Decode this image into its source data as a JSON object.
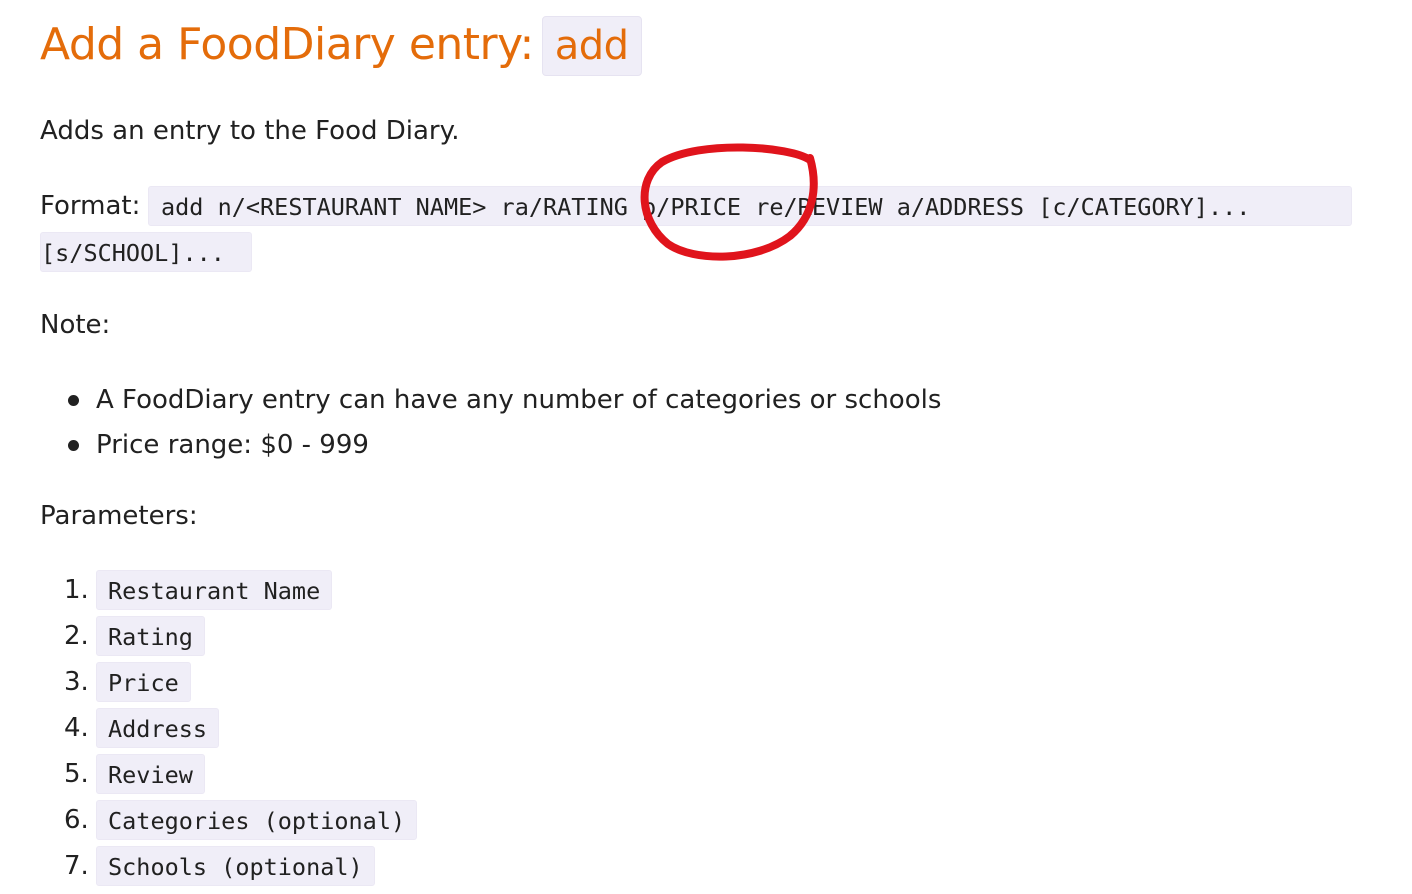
{
  "heading": {
    "text": "Add a FoodDiary entry:",
    "code": "add"
  },
  "intro": "Adds an entry to the Food Diary.",
  "format": {
    "label": "Format:",
    "line1": "add n/<RESTAURANT NAME> ra/RATING p/PRICE re/REVIEW a/ADDRESS [c/CATEGORY]...",
    "line2": "[s/SCHOOL]..."
  },
  "note_label": "Note:",
  "notes": [
    "A FoodDiary entry can have any number of categories or schools",
    "Price range: $0 - 999"
  ],
  "parameters_label": "Parameters:",
  "parameters": [
    {
      "num": "1.",
      "label": "Restaurant Name"
    },
    {
      "num": "2.",
      "label": "Rating"
    },
    {
      "num": "3.",
      "label": "Price"
    },
    {
      "num": "4.",
      "label": "Address"
    },
    {
      "num": "5.",
      "label": "Review"
    },
    {
      "num": "6.",
      "label": "Categories (optional)"
    },
    {
      "num": "7.",
      "label": "Schools (optional)"
    }
  ],
  "colors": {
    "heading": "#e46c0a",
    "code_background": "#f0eef8",
    "annotation_circle": "#e0141c"
  }
}
